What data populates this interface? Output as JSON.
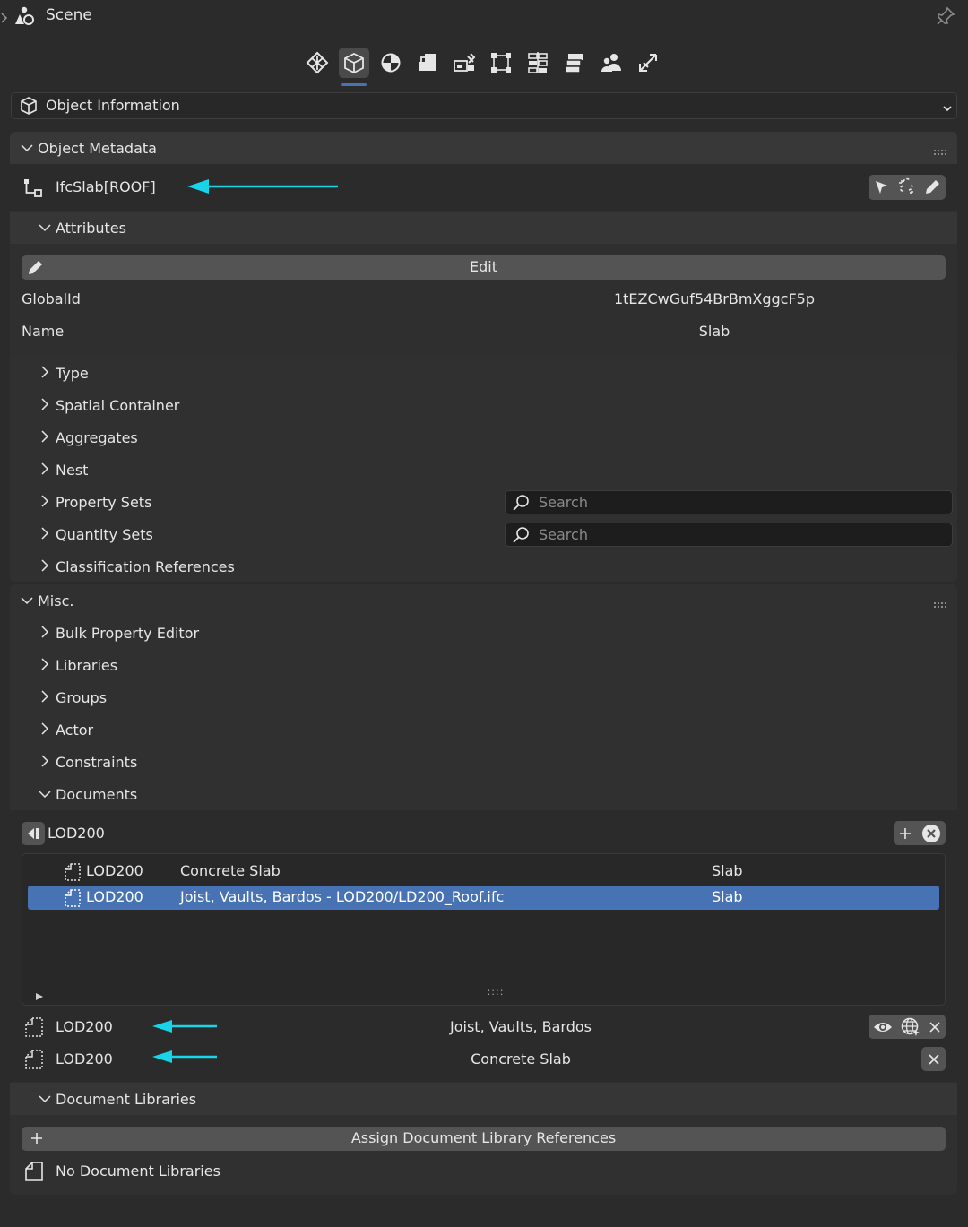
{
  "header": {
    "title": "Scene"
  },
  "tabs": [
    {
      "name": "tab-project"
    },
    {
      "name": "tab-object",
      "active": true
    },
    {
      "name": "tab-geometry"
    },
    {
      "name": "tab-materials"
    },
    {
      "name": "tab-services"
    },
    {
      "name": "tab-structural"
    },
    {
      "name": "tab-costing"
    },
    {
      "name": "tab-stacks"
    },
    {
      "name": "tab-users"
    },
    {
      "name": "tab-quality"
    }
  ],
  "object_info": {
    "label": "Object Information"
  },
  "metadata": {
    "title": "Object Metadata",
    "entity": "IfcSlab[ROOF]",
    "attributes_title": "Attributes",
    "edit_label": "Edit",
    "fields": [
      {
        "key": "GlobalId",
        "value": "1tEZCwGuf54BrBmXggcF5p"
      },
      {
        "key": "Name",
        "value": "Slab"
      }
    ],
    "subsections": [
      "Type",
      "Spatial Container",
      "Aggregates",
      "Nest",
      "Property Sets",
      "Quantity Sets",
      "Classification References"
    ],
    "search_placeholder": "Search"
  },
  "misc": {
    "title": "Misc.",
    "subsections": [
      "Bulk Property Editor",
      "Libraries",
      "Groups",
      "Actor",
      "Constraints"
    ],
    "documents": {
      "title": "Documents",
      "selector": "LOD200",
      "list": [
        {
          "ref": "LOD200",
          "desc": "Concrete Slab",
          "type": "Slab",
          "selected": false
        },
        {
          "ref": "LOD200",
          "desc": "Joist, Vaults, Bardos - LOD200/LD200_Roof.ifc",
          "type": "Slab",
          "selected": true
        }
      ],
      "grip": "::::",
      "assigned": [
        {
          "ref": "LOD200",
          "desc": "Joist, Vaults, Bardos"
        },
        {
          "ref": "LOD200",
          "desc": "Concrete Slab"
        }
      ]
    },
    "doc_libraries": {
      "title": "Document Libraries",
      "assign_label": "Assign Document Library References",
      "empty_label": "No Document Libraries"
    }
  },
  "colors": {
    "accent": "#4772b3",
    "annotation_arrow": "#19d4e8",
    "bg": "#2b2b2b",
    "panel": "#303030"
  }
}
